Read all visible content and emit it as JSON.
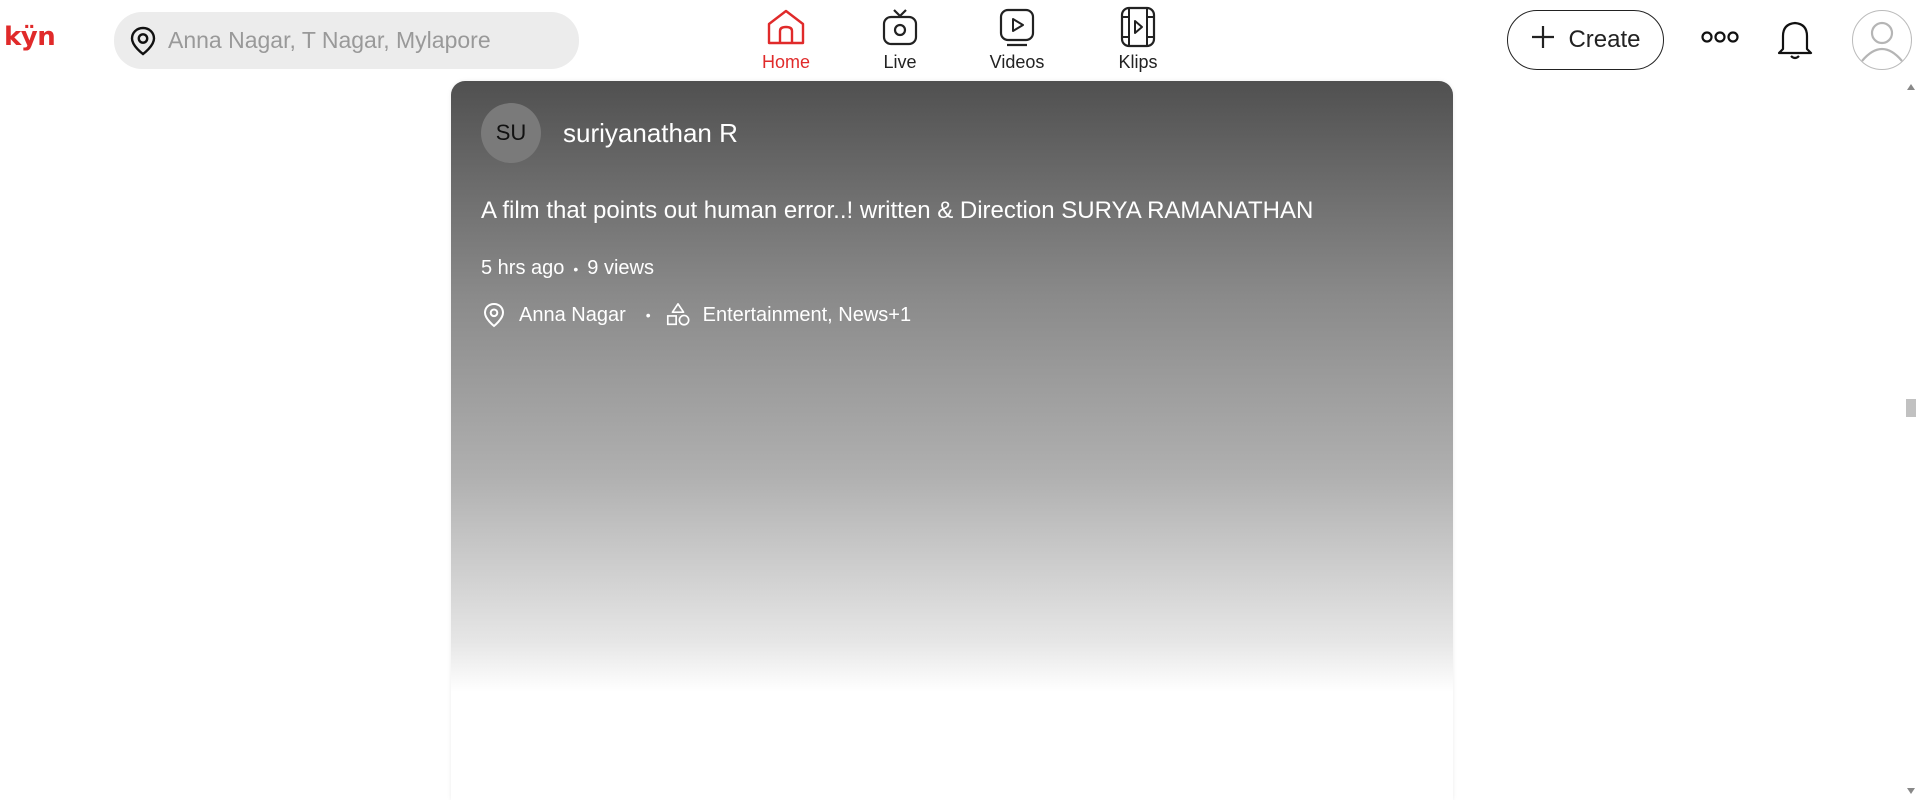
{
  "app": {
    "logo": "kÿn",
    "accent": "#e02a2a"
  },
  "search": {
    "placeholder": "Anna Nagar, T Nagar, Mylapore",
    "value": "",
    "icon": "location-pin-icon"
  },
  "nav": [
    {
      "label": "Home",
      "icon": "home-icon",
      "active": true
    },
    {
      "label": "Live",
      "icon": "live-tv-icon",
      "active": false
    },
    {
      "label": "Videos",
      "icon": "video-play-icon",
      "active": false
    },
    {
      "label": "Klips",
      "icon": "klips-film-icon",
      "active": false
    }
  ],
  "header_actions": {
    "create_label": "Create",
    "create_icon": "plus-icon",
    "more_icon": "more-dots-icon",
    "notifications_icon": "bell-icon",
    "profile_icon": "user-avatar-icon"
  },
  "post": {
    "author_initials": "SU",
    "author_name": "suriyanathan R",
    "title": "A film that points out human error..! written & Direction SURYA RAMANATHAN",
    "time_ago": "5 hrs ago",
    "views": "9 views",
    "location": "Anna Nagar",
    "categories": "Entertainment, News+1"
  }
}
